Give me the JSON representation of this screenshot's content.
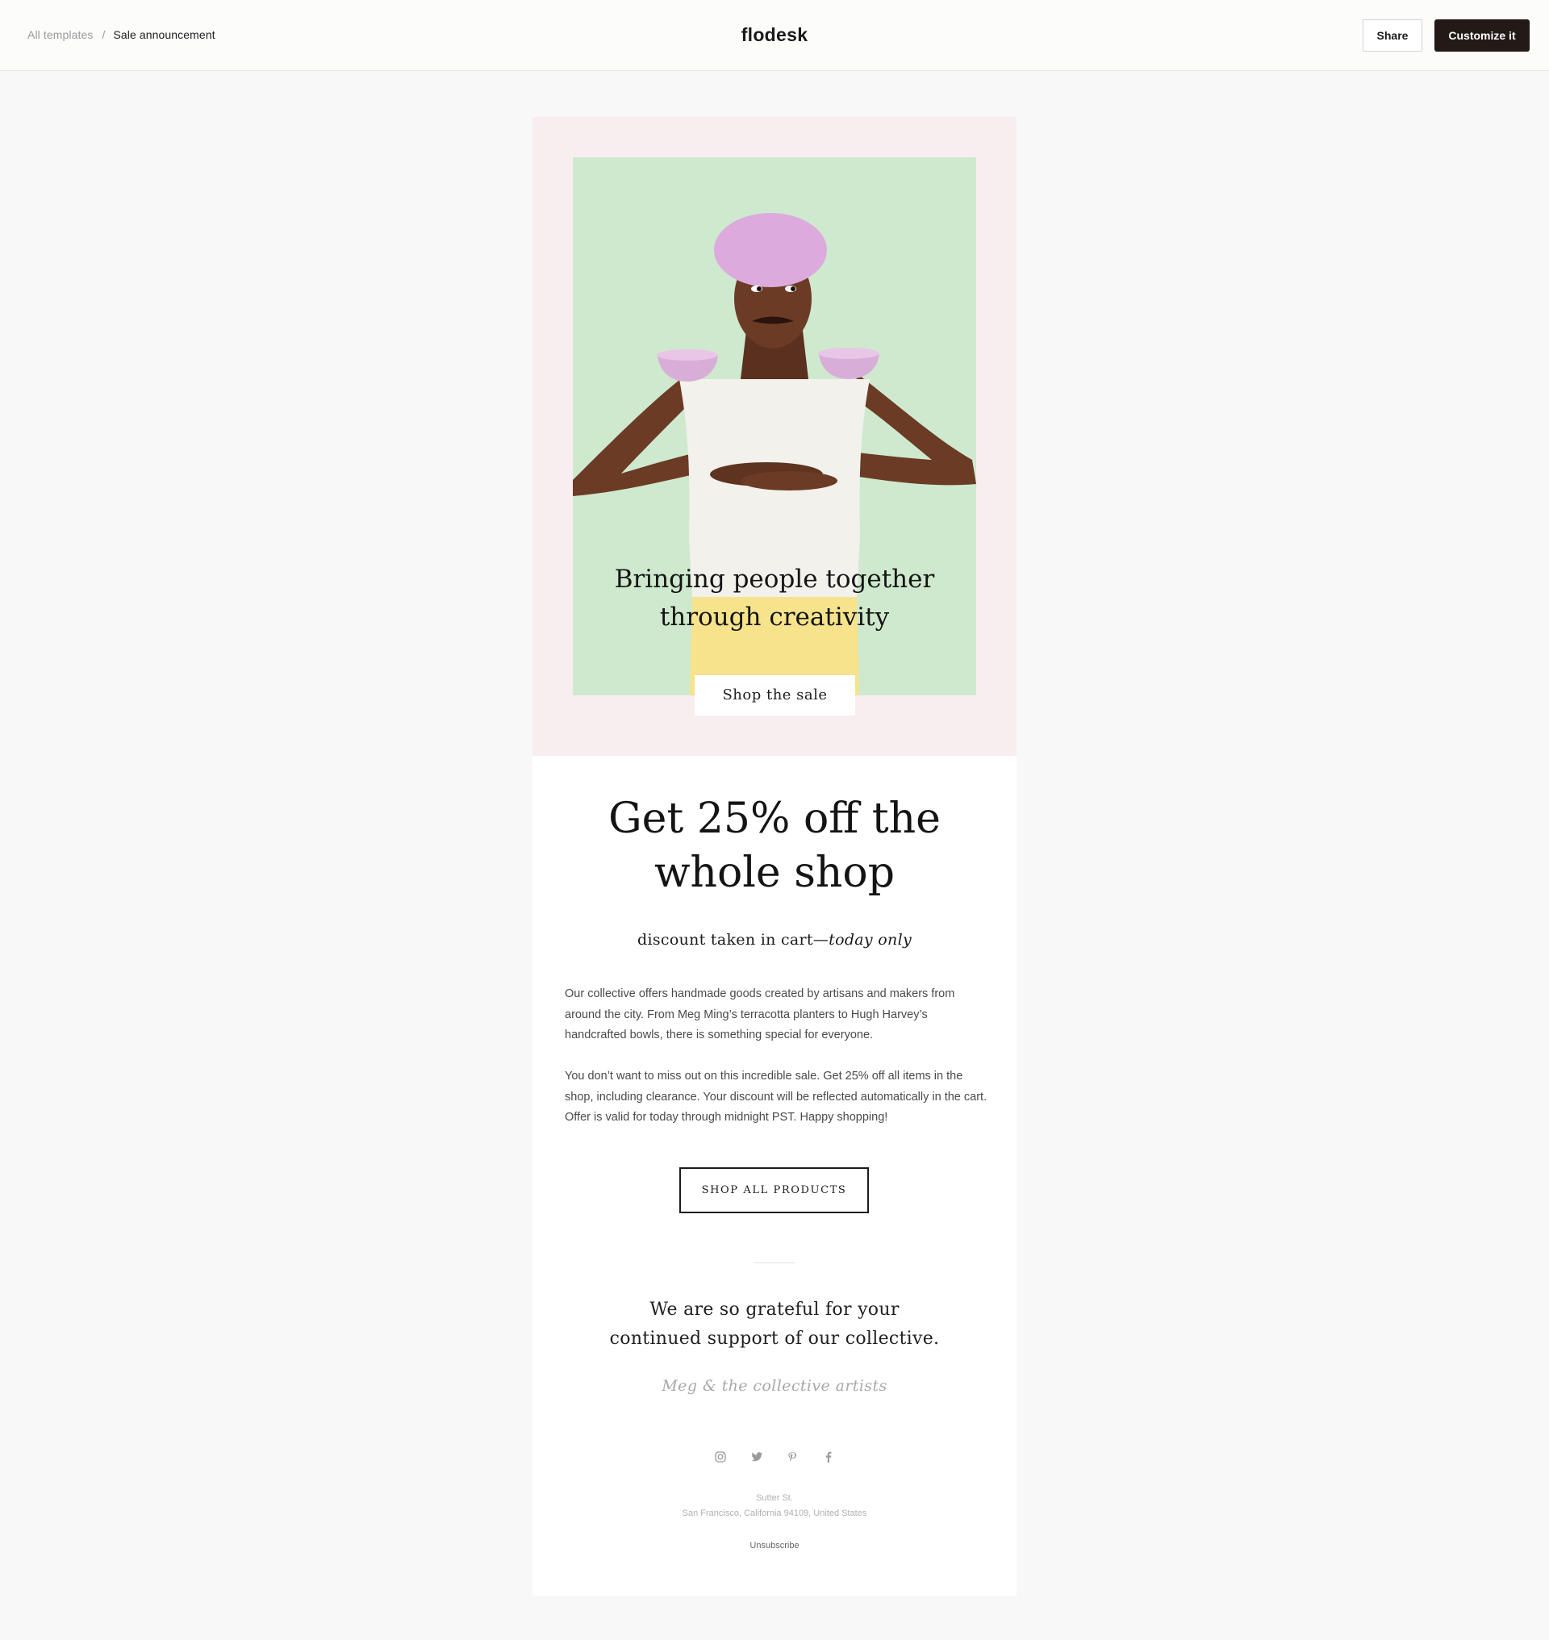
{
  "header": {
    "breadcrumb_parent": "All templates",
    "breadcrumb_separator": "/",
    "breadcrumb_current": "Sale announcement",
    "brand": "flodesk",
    "share_label": "Share",
    "customize_label": "Customize it"
  },
  "hero": {
    "title_line1": "Bringing people together",
    "title_line2": "through creativity",
    "button_label": "Shop the sale"
  },
  "offer": {
    "headline_line1": "Get 25% off the",
    "headline_line2": "whole shop",
    "sub_plain": "discount taken in cart—",
    "sub_italic": "today only",
    "paragraph1": "Our collective offers handmade goods created by artisans and makers from around the city. From Meg Ming’s terracotta planters to Hugh Harvey’s handcrafted bowls, there is something special for everyone.",
    "paragraph2": "You don’t want to miss out on this incredible sale. Get 25% off all items in the shop, including clearance. Your discount will be reflected automatically in the cart. Offer is valid for today through midnight PST. Happy shopping!",
    "cta_label": "SHOP ALL PRODUCTS"
  },
  "closing": {
    "thanks_line1": "We are so grateful for your",
    "thanks_line2": "continued support of our collective.",
    "signoff": "Meg & the collective artists"
  },
  "footer": {
    "socials": [
      "instagram-icon",
      "twitter-icon",
      "pinterest-icon",
      "facebook-icon"
    ],
    "address_line1": "Sutter St.",
    "address_line2": "San Francisco, California 94109, United States",
    "unsubscribe": "Unsubscribe"
  },
  "colors": {
    "page_bg": "#f8f8f8",
    "hero_bg": "#f8eeef",
    "photo_bg": "#cce8cc",
    "primary_button": "#231a18"
  }
}
